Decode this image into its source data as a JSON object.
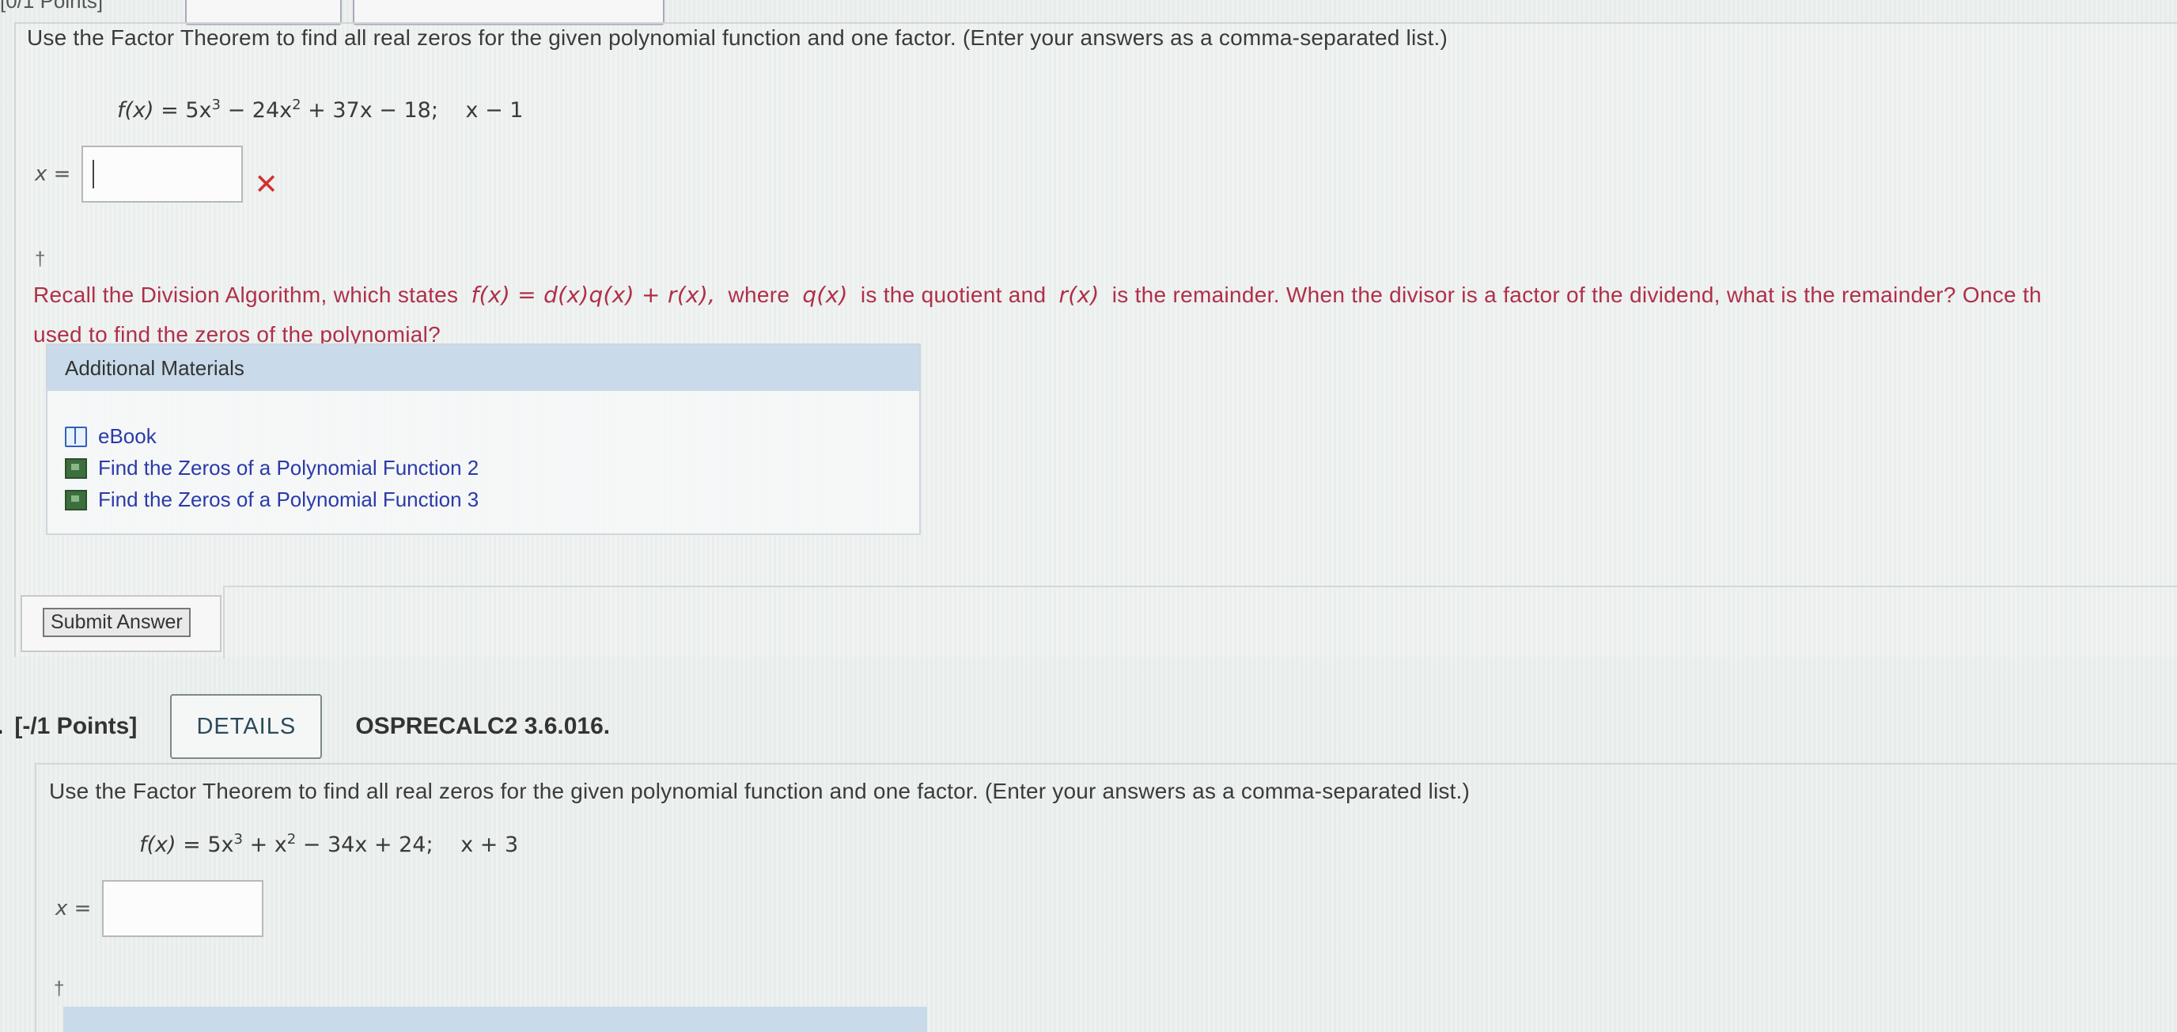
{
  "top_strip": {
    "clipped_text": "[0/1 Points]"
  },
  "question1": {
    "prompt": "Use the Factor Theorem to find all real zeros for the given polynomial function and one factor. (Enter your answers as a comma-separated list.)",
    "function_lhs": "f(x)",
    "function_rhs": "= 5x",
    "exp1": "3",
    "term2": " − 24x",
    "exp2": "2",
    "term3": " + 37x − 18;",
    "factor": "x − 1",
    "answer_label": "x =",
    "answer_value": "",
    "incorrect_mark": "✕",
    "dagger": "†",
    "hint_line1": "Recall the Division Algorithm, which states",
    "hint_formula": "f(x) = d(x)q(x) + r(x),",
    "hint_where": "where",
    "hint_q": "q(x)",
    "hint_quotient": "is the quotient and",
    "hint_r": "r(x)",
    "hint_rest": "is the remainder. When the divisor is a factor of the dividend, what is the remainder? Once th",
    "hint_line2": "used to find the zeros of the polynomial?",
    "materials": {
      "header": "Additional Materials",
      "items": [
        "eBook",
        "Find the Zeros of a Polynomial Function 2",
        "Find the Zeros of a Polynomial Function 3"
      ]
    },
    "submit_label": "Submit Answer"
  },
  "question2": {
    "number": ".",
    "points": "[-/1 Points]",
    "details_label": "DETAILS",
    "source": "OSPRECALC2 3.6.016.",
    "prompt": "Use the Factor Theorem to find all real zeros for the given polynomial function and one factor. (Enter your answers as a comma-separated list.)",
    "function_lhs": "f(x)",
    "function_rhs": "= 5x",
    "exp1": "3",
    "term2": " + x",
    "exp2": "2",
    "term3": " − 34x + 24;",
    "factor": "x + 3",
    "answer_label": "x =",
    "answer_value": "",
    "dagger": "†"
  },
  "colors": {
    "hint_red": "#b02f48",
    "link_blue": "#2b3aa8",
    "materials_header": "#c9dbea",
    "incorrect_red": "#d32f2f"
  },
  "icons": {
    "ebook": "book-icon",
    "video": "video-icon",
    "incorrect": "close-icon"
  }
}
